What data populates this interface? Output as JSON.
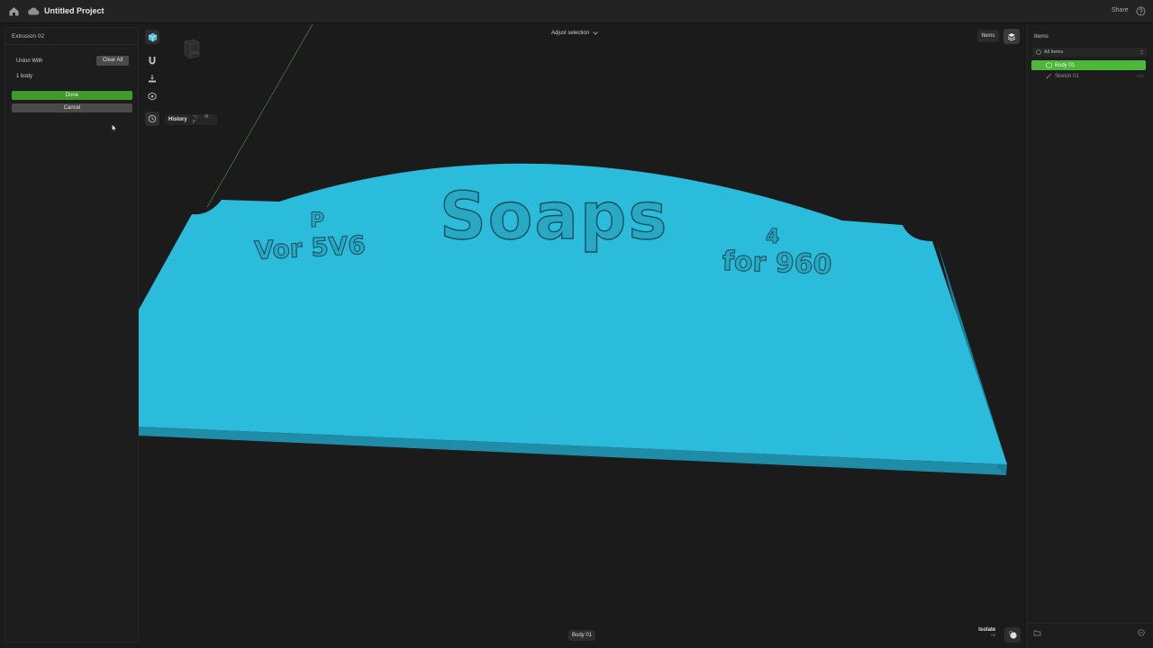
{
  "topbar": {
    "project_title": "Untitled Project",
    "share_label": "Share",
    "icons": [
      "home-icon",
      "cloud-icon",
      "help-icon"
    ]
  },
  "left_panel": {
    "title": "Extrusion 02",
    "union_label": "Union With",
    "clear_all_label": "Clear All",
    "body_count": "1 body",
    "done_label": "Done",
    "cancel_label": "Cancel"
  },
  "toolbar": {
    "history_label": "History",
    "history_keys": "⌥ ⌘ P",
    "tools": [
      "cube-icon",
      "magnet-icon",
      "ground-icon",
      "focus-icon",
      "history-icon"
    ]
  },
  "viewport": {
    "adjust_selection_label": "Adjust selection",
    "model_text_center": "Soaps",
    "model_text_left": "Vor 5V6",
    "model_text_right": "for 960",
    "body_color": "#2bbcdc",
    "edge_color": "#1f8ca8"
  },
  "items_toggle_label": "Items",
  "right_panel": {
    "title": "Items",
    "filter_label": "All Items",
    "items": [
      {
        "label": "Body 01",
        "selected": true
      },
      {
        "label": "Sketch 01",
        "selected": false
      }
    ],
    "accent": "#4db83a"
  },
  "bottom": {
    "selected_chip": "Body 01",
    "isolate_label": "Isolate",
    "isolate_state": "Off"
  }
}
